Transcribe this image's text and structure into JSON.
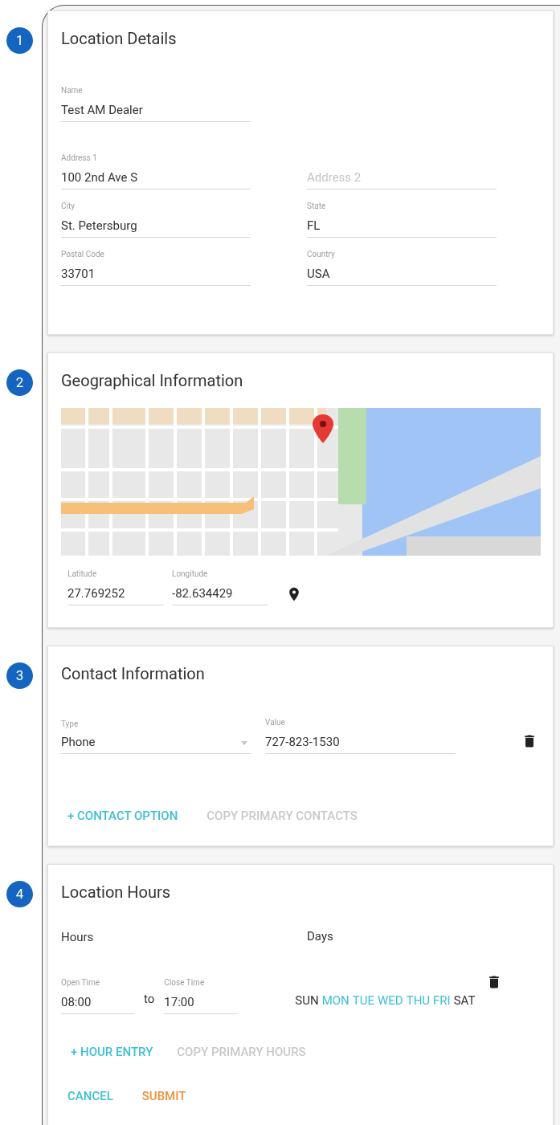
{
  "sections": [
    {
      "kind": "details",
      "number": "1",
      "title": "Location Details",
      "fields": [
        [
          {
            "label": "Name",
            "value": "Test AM Dealer"
          }
        ],
        [
          {
            "label": "Address 1",
            "value": "100 2nd Ave S"
          },
          {
            "placeholder": "Address 2"
          }
        ],
        [
          {
            "label": "City",
            "value": "St. Petersburg"
          },
          {
            "label": "State",
            "value": "FL"
          }
        ],
        [
          {
            "label": "Postal Code",
            "value": "33701"
          },
          {
            "label": "Country",
            "value": "USA"
          }
        ]
      ]
    },
    {
      "kind": "geo",
      "number": "2",
      "title": "Geographical Information",
      "latitude": {
        "label": "Latitude",
        "value": "27.769252"
      },
      "longitude": {
        "label": "Longitude",
        "value": "-82.634429"
      }
    },
    {
      "kind": "contact",
      "number": "3",
      "title": "Contact Information",
      "type_field": {
        "label": "Type",
        "value": "Phone"
      },
      "value_field": {
        "label": "Value",
        "value": "727-823-1530"
      },
      "actions": [
        {
          "label": "+ CONTACT OPTION",
          "disabled": false
        },
        {
          "label": "COPY PRIMARY CONTACTS",
          "disabled": true
        }
      ]
    },
    {
      "kind": "hours",
      "number": "4",
      "title": "Location Hours",
      "hours_heading": "Hours",
      "days_heading": "Days",
      "open_time": {
        "label": "Open Time",
        "value": "08:00"
      },
      "separator": "to",
      "close_time": {
        "label": "Close Time",
        "value": "17:00"
      },
      "days": [
        {
          "label": "SUN",
          "selected": false
        },
        {
          "label": "MON",
          "selected": true
        },
        {
          "label": "TUE",
          "selected": true
        },
        {
          "label": "WED",
          "selected": true
        },
        {
          "label": "THU",
          "selected": true
        },
        {
          "label": "FRI",
          "selected": true
        },
        {
          "label": "SAT",
          "selected": false
        }
      ],
      "actions": [
        {
          "label": "+ HOUR ENTRY",
          "disabled": false
        },
        {
          "label": "COPY PRIMARY HOURS",
          "disabled": true
        }
      ],
      "form_buttons": [
        {
          "label": "CANCEL",
          "kind": "cancel"
        },
        {
          "label": "SUBMIT",
          "kind": "submit"
        }
      ]
    }
  ]
}
